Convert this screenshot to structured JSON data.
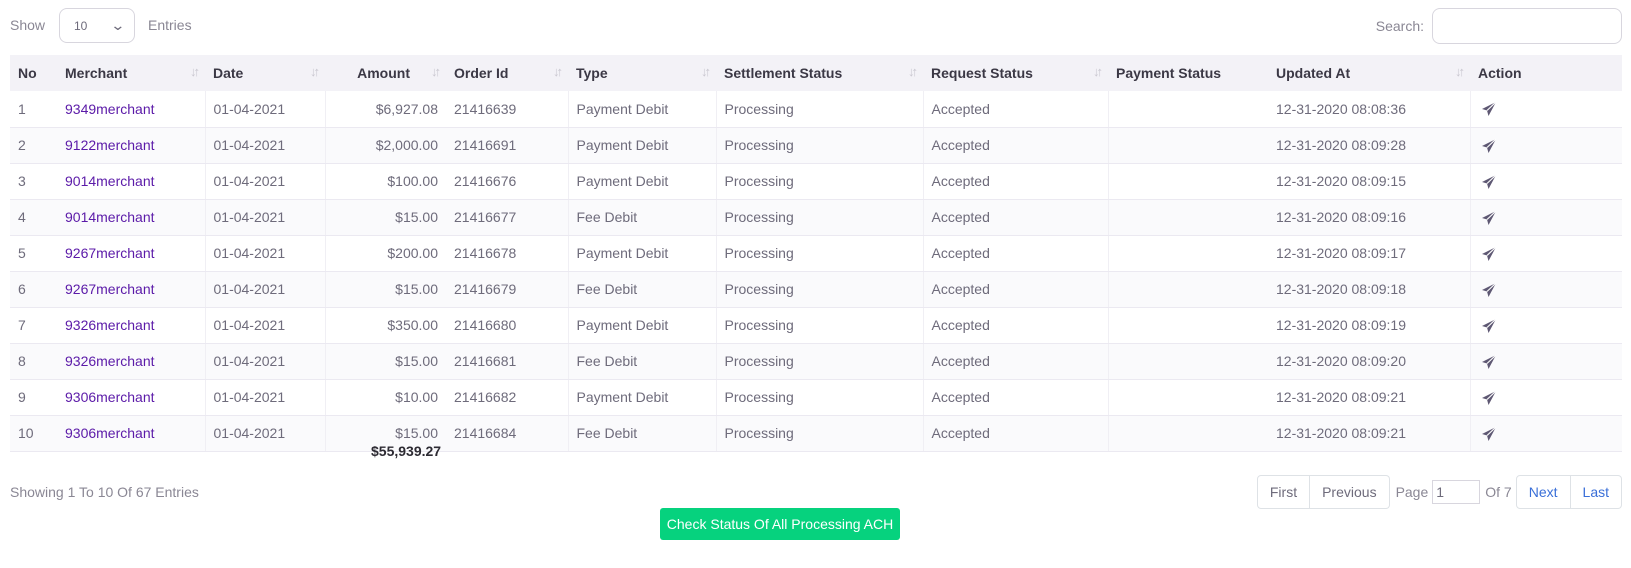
{
  "length_control": {
    "show_label": "Show",
    "selected": "10",
    "entries_label": "Entries"
  },
  "search": {
    "label": "Search:",
    "value": ""
  },
  "table": {
    "headers": [
      "No",
      "Merchant",
      "Date",
      "Amount",
      "Order Id",
      "Type",
      "Settlement Status",
      "Request Status",
      "Payment Status",
      "Updated At",
      "Action"
    ],
    "rows": [
      {
        "no": "1",
        "merchant": "9349merchant",
        "date": "01-04-2021",
        "amount": "$6,927.08",
        "order_id": "21416639",
        "type": "Payment Debit",
        "settlement_status": "Processing",
        "request_status": "Accepted",
        "payment_status": "",
        "updated_at": "12-31-2020 08:08:36"
      },
      {
        "no": "2",
        "merchant": "9122merchant",
        "date": "01-04-2021",
        "amount": "$2,000.00",
        "order_id": "21416691",
        "type": "Payment Debit",
        "settlement_status": "Processing",
        "request_status": "Accepted",
        "payment_status": "",
        "updated_at": "12-31-2020 08:09:28"
      },
      {
        "no": "3",
        "merchant": "9014merchant",
        "date": "01-04-2021",
        "amount": "$100.00",
        "order_id": "21416676",
        "type": "Payment Debit",
        "settlement_status": "Processing",
        "request_status": "Accepted",
        "payment_status": "",
        "updated_at": "12-31-2020 08:09:15"
      },
      {
        "no": "4",
        "merchant": "9014merchant",
        "date": "01-04-2021",
        "amount": "$15.00",
        "order_id": "21416677",
        "type": "Fee Debit",
        "settlement_status": "Processing",
        "request_status": "Accepted",
        "payment_status": "",
        "updated_at": "12-31-2020 08:09:16"
      },
      {
        "no": "5",
        "merchant": "9267merchant",
        "date": "01-04-2021",
        "amount": "$200.00",
        "order_id": "21416678",
        "type": "Payment Debit",
        "settlement_status": "Processing",
        "request_status": "Accepted",
        "payment_status": "",
        "updated_at": "12-31-2020 08:09:17"
      },
      {
        "no": "6",
        "merchant": "9267merchant",
        "date": "01-04-2021",
        "amount": "$15.00",
        "order_id": "21416679",
        "type": "Fee Debit",
        "settlement_status": "Processing",
        "request_status": "Accepted",
        "payment_status": "",
        "updated_at": "12-31-2020 08:09:18"
      },
      {
        "no": "7",
        "merchant": "9326merchant",
        "date": "01-04-2021",
        "amount": "$350.00",
        "order_id": "21416680",
        "type": "Payment Debit",
        "settlement_status": "Processing",
        "request_status": "Accepted",
        "payment_status": "",
        "updated_at": "12-31-2020 08:09:19"
      },
      {
        "no": "8",
        "merchant": "9326merchant",
        "date": "01-04-2021",
        "amount": "$15.00",
        "order_id": "21416681",
        "type": "Fee Debit",
        "settlement_status": "Processing",
        "request_status": "Accepted",
        "payment_status": "",
        "updated_at": "12-31-2020 08:09:20"
      },
      {
        "no": "9",
        "merchant": "9306merchant",
        "date": "01-04-2021",
        "amount": "$10.00",
        "order_id": "21416682",
        "type": "Payment Debit",
        "settlement_status": "Processing",
        "request_status": "Accepted",
        "payment_status": "",
        "updated_at": "12-31-2020 08:09:21"
      },
      {
        "no": "10",
        "merchant": "9306merchant",
        "date": "01-04-2021",
        "amount": "$15.00",
        "order_id": "21416684",
        "type": "Fee Debit",
        "settlement_status": "Processing",
        "request_status": "Accepted",
        "payment_status": "",
        "updated_at": "12-31-2020 08:09:21"
      }
    ],
    "action_icon": "send-icon",
    "total_amount": "$55,939.27"
  },
  "footer": {
    "showing_text": "Showing 1 To 10 Of 67 Entries",
    "pagination": {
      "first": "First",
      "previous": "Previous",
      "page_label": "Page",
      "page_value": "1",
      "of_label": "Of 7",
      "next": "Next",
      "last": "Last"
    }
  },
  "check_status_button": {
    "label": "Check Status Of All Processing ACH"
  },
  "colors": {
    "accent_green": "#06d27e",
    "merchant_link": "#5b1aa8",
    "header_bg": "#f3f2f7",
    "pager_link": "#3a6fd8"
  }
}
